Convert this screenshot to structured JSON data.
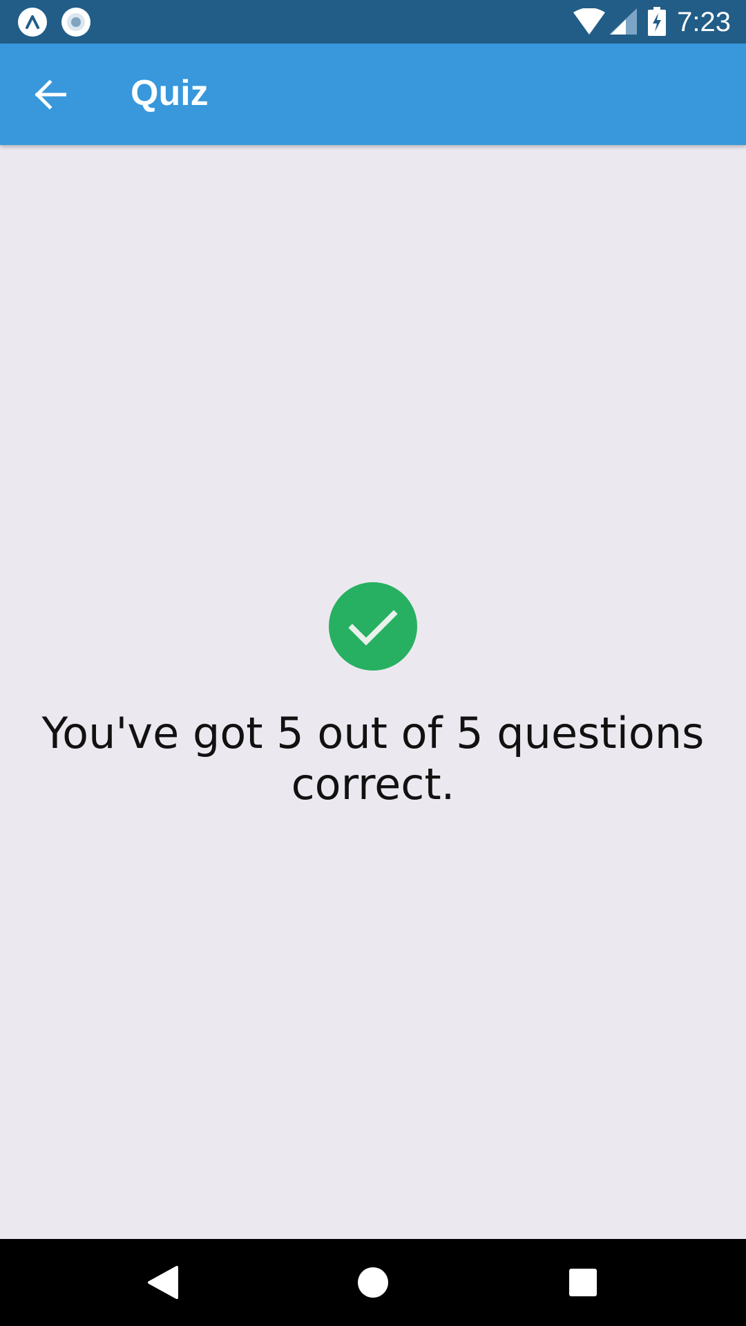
{
  "status_bar": {
    "time": "7:23",
    "left_icons": [
      "expo-icon",
      "record-icon"
    ],
    "right_icons": [
      "wifi-icon",
      "cellular-signal-icon",
      "battery-charging-icon"
    ],
    "background_color": "#215d87"
  },
  "app_bar": {
    "title": "Quiz",
    "back_icon": "arrow-left-icon",
    "background_color": "#3898db"
  },
  "result": {
    "icon": "check-circle-icon",
    "icon_color": "#27b061",
    "message": "You've got 5 out of 5 questions correct."
  },
  "nav_bar": {
    "buttons": [
      "back-triangle-icon",
      "home-circle-icon",
      "recents-square-icon"
    ]
  }
}
